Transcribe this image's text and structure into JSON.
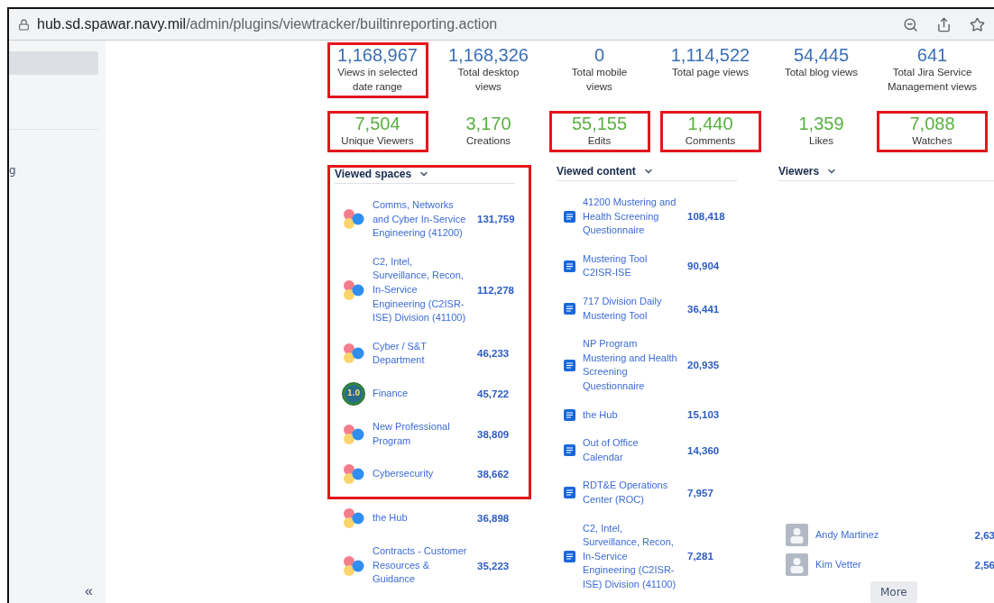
{
  "browser": {
    "url_host": "hub.sd.spawar.navy.mil",
    "url_path": "/admin/plugins/viewtracker/builtinreporting.action"
  },
  "sidebar": {
    "items": [
      {
        "selected": true
      },
      {
        "label": "g",
        "selected": false
      }
    ],
    "collapse": "«"
  },
  "stats_primary": [
    {
      "value": "1,168,967",
      "label": "Views in selected date range",
      "highlighted": true
    },
    {
      "value": "1,168,326",
      "label": "Total desktop views",
      "highlighted": false
    },
    {
      "value": "0",
      "label": "Total mobile views",
      "highlighted": false
    },
    {
      "value": "1,114,522",
      "label": "Total page views",
      "highlighted": false
    },
    {
      "value": "54,445",
      "label": "Total blog views",
      "highlighted": false
    },
    {
      "value": "641",
      "label": "Total Jira Service Management views",
      "highlighted": false
    }
  ],
  "stats_secondary": [
    {
      "value": "7,504",
      "label": "Unique Viewers",
      "highlighted": true
    },
    {
      "value": "3,170",
      "label": "Creations",
      "highlighted": false
    },
    {
      "value": "55,155",
      "label": "Edits",
      "highlighted": true
    },
    {
      "value": "1,440",
      "label": "Comments",
      "highlighted": true
    },
    {
      "value": "1,359",
      "label": "Likes",
      "highlighted": false
    },
    {
      "value": "7,088",
      "label": "Watches",
      "highlighted": true
    }
  ],
  "viewed_spaces": {
    "title": "Viewed spaces",
    "rows": [
      {
        "kind": "blob",
        "name": "Comms, Networks and Cyber In-Service Engineering (41200)",
        "count": "131,759",
        "highlighted": true
      },
      {
        "kind": "blob",
        "name": "C2, Intel, Surveillance, Recon, In-Service Engineering (C2ISR-ISE) Division (41100)",
        "count": "112,278",
        "highlighted": true
      },
      {
        "kind": "blob",
        "name": "Cyber / S&T Department",
        "count": "46,233",
        "highlighted": true
      },
      {
        "kind": "badge",
        "badge_text": "1.0",
        "name": "Finance",
        "count": "45,722",
        "highlighted": true
      },
      {
        "kind": "blob",
        "name": "New Professional Program",
        "count": "38,809",
        "highlighted": true
      },
      {
        "kind": "blob",
        "name": "Cybersecurity",
        "count": "38,662",
        "highlighted": true
      },
      {
        "kind": "blob",
        "name": "the Hub",
        "count": "36,898",
        "highlighted": false
      },
      {
        "kind": "blob",
        "name": "Contracts - Customer Resources & Guidance",
        "count": "35,223",
        "highlighted": false
      }
    ]
  },
  "viewed_content": {
    "title": "Viewed content",
    "rows": [
      {
        "name": "41200 Mustering and Health Screening Questionnaire",
        "count": "108,418"
      },
      {
        "name": "Mustering Tool C2ISR-ISE",
        "count": "90,904"
      },
      {
        "name": "717 Division Daily Mustering Tool",
        "count": "36,441"
      },
      {
        "name": "NP Program Mustering and Health Screening Questionnaire",
        "count": "20,935"
      },
      {
        "name": "the Hub",
        "count": "15,103"
      },
      {
        "name": "Out of Office Calendar",
        "count": "14,360"
      },
      {
        "name": "RDT&E Operations Center (ROC)",
        "count": "7,957"
      },
      {
        "name": "C2, Intel, Surveillance, Recon, In-Service Engineering (C2ISR-ISE) Division (41100)",
        "count": "7,281"
      }
    ]
  },
  "viewers": {
    "title": "Viewers",
    "rows": [
      {
        "name": "Andy Martinez",
        "count": "2,63"
      },
      {
        "name": "Kim Vetter",
        "count": "2,56"
      }
    ],
    "more": "More"
  }
}
